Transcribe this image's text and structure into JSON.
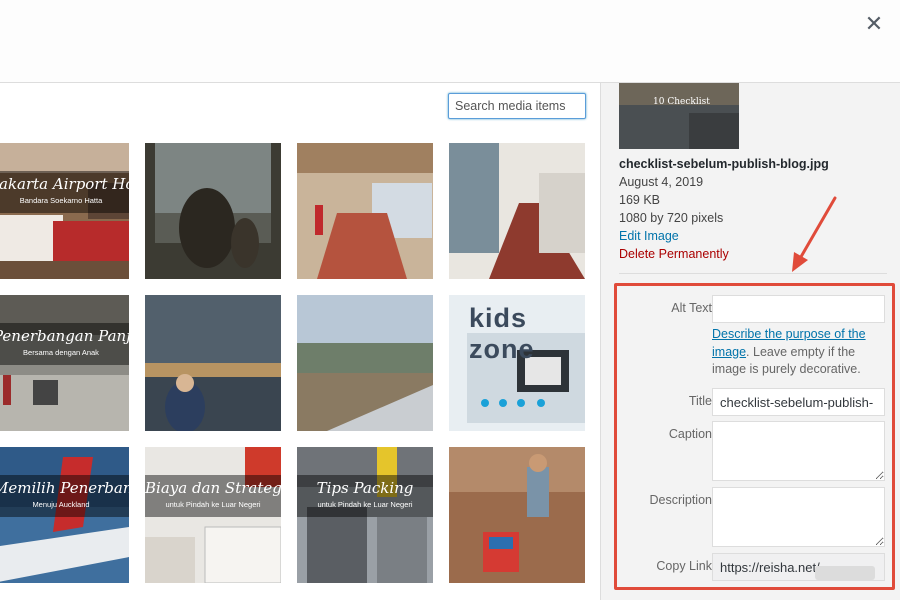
{
  "close_label": "✕",
  "search": {
    "placeholder": "Search media items."
  },
  "thumbnails": [
    {
      "name": "thumb-jakarta-airport-hotel",
      "caption": "Jakarta Airport Hotel",
      "sub": "Bandara Soekarno Hatta"
    },
    {
      "name": "thumb-window-silhouette",
      "caption": "",
      "sub": ""
    },
    {
      "name": "thumb-hotel-staircase",
      "caption": "",
      "sub": ""
    },
    {
      "name": "thumb-hotel-corridor",
      "caption": "",
      "sub": ""
    },
    {
      "name": "thumb-penerbangan-panjang",
      "caption": "Penerbangan Panjang",
      "sub": "Bersama dengan Anak"
    },
    {
      "name": "thumb-airport-window-child",
      "caption": "",
      "sub": ""
    },
    {
      "name": "thumb-aerial-view",
      "caption": "",
      "sub": ""
    },
    {
      "name": "thumb-kids-zone",
      "caption": "",
      "sub": "",
      "kids": "kids zone"
    },
    {
      "name": "thumb-memilih-penerbangan",
      "caption": "Memilih Penerbangan",
      "sub": "Menuju Auckland"
    },
    {
      "name": "thumb-biaya-dan-strategi",
      "caption": "Biaya dan Strategi",
      "sub": "untuk Pindah ke Luar Negeri"
    },
    {
      "name": "thumb-tips-packing",
      "caption": "Tips Packing",
      "sub": "untuk Pindah ke Luar Negeri"
    },
    {
      "name": "thumb-child-with-luggage",
      "caption": "",
      "sub": ""
    }
  ],
  "attachment": {
    "thumb_label": "10 Checklist",
    "filename": "checklist-sebelum-publish-blog.jpg",
    "date": "August 4, 2019",
    "size": "169 KB",
    "dimensions": "1080 by 720 pixels",
    "edit_label": "Edit Image",
    "delete_label": "Delete Permanently"
  },
  "settings": {
    "alt_label": "Alt Text",
    "alt_value": "",
    "alt_help_link": "Describe the purpose of the image",
    "alt_help_rest": ". Leave empty if the image is purely decorative.",
    "title_label": "Title",
    "title_value": "checklist-sebelum-publish-",
    "caption_label": "Caption",
    "caption_value": "",
    "description_label": "Description",
    "description_value": "",
    "copy_label": "Copy Link",
    "copy_value": "https://reisha.net/"
  },
  "colors": {
    "highlight": "#e04b3a",
    "link": "#0073aa",
    "danger": "#aa0000"
  }
}
